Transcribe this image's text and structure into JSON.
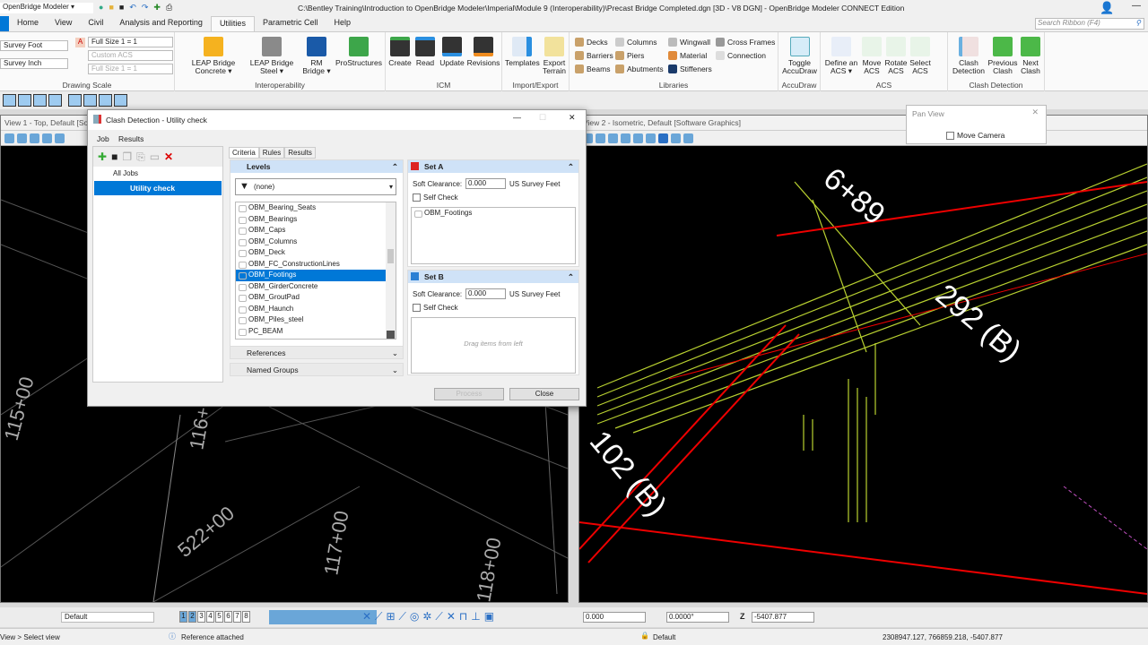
{
  "app": {
    "name": "OpenBridge Modeler",
    "title": "C:\\Bentley Training\\Introduction to OpenBridge Modeler\\Imperial\\Module 9 (Interoperability)\\Precast Bridge Completed.dgn [3D - V8 DGN] - OpenBridge Modeler CONNECT Edition",
    "search_placeholder": "Search Ribbon (F4)"
  },
  "tabs": [
    "Home",
    "View",
    "Civil",
    "Analysis and Reporting",
    "Utilities",
    "Parametric Cell",
    "Help"
  ],
  "ribbon": {
    "drawing_scale": {
      "label": "Drawing Scale",
      "unit1": "Survey Foot",
      "unit2": "Survey Inch",
      "scale1": "Full Size 1 = 1",
      "scale2": "Custom ACS",
      "scale3": "Full Size 1 = 1"
    },
    "interop": {
      "label": "Interoperability",
      "b1": "LEAP Bridge Concrete ▾",
      "b2": "LEAP Bridge Steel ▾",
      "b3": "RM Bridge ▾",
      "b4": "ProStructures"
    },
    "icm": {
      "label": "ICM",
      "b": [
        "Create",
        "Read",
        "Update",
        "Revisions"
      ]
    },
    "importexport": {
      "label": "Import/Export",
      "b1": "Templates",
      "b2": "Export Terrain"
    },
    "libraries": {
      "label": "Libraries",
      "items": [
        "Decks",
        "Barriers",
        "Beams",
        "Columns",
        "Piers",
        "Abutments",
        "Wingwall",
        "Material",
        "Stiffeners",
        "Cross Frames",
        "Connection"
      ]
    },
    "accudraw": {
      "label": "AccuDraw",
      "b": "Toggle AccuDraw"
    },
    "acs": {
      "label": "ACS",
      "b": [
        "Define an ACS ▾",
        "Move ACS",
        "Rotate ACS",
        "Select ACS"
      ]
    },
    "clash": {
      "label": "Clash Detection",
      "b": [
        "Clash Detection",
        "Previous Clash",
        "Next Clash"
      ]
    }
  },
  "views": {
    "v1": "View 1 - Top, Default [Software Graphics]",
    "v2": "View 2 - Isometric, Default [Software Graphics]",
    "v1_labels": [
      "115+00",
      "116+00",
      "522+00",
      "117+00",
      "118+00"
    ],
    "v2_labels": [
      "6+89",
      "292 (B)",
      "102 (B)"
    ]
  },
  "pan_view": {
    "title": "Pan View",
    "move_camera": "Move Camera"
  },
  "dialog": {
    "title": "Clash Detection - Utility check",
    "menu": [
      "Job",
      "Results"
    ],
    "tree": {
      "all": "All Jobs",
      "job": "Utility check"
    },
    "tabs": [
      "Criteria",
      "Rules",
      "Results"
    ],
    "levels_header": "Levels",
    "filter": "(none)",
    "levels": [
      "OBM_Bearing_Seats",
      "OBM_Bearings",
      "OBM_Caps",
      "OBM_Columns",
      "OBM_Deck",
      "OBM_FC_ConstructionLines",
      "OBM_Footings",
      "OBM_GirderConcrete",
      "OBM_GroutPad",
      "OBM_Haunch",
      "OBM_Piles_steel",
      "PC_BEAM"
    ],
    "selected_level": "OBM_Footings",
    "references": "References",
    "named_groups": "Named Groups",
    "setA": {
      "title": "Set A",
      "soft_label": "Soft Clearance:",
      "soft_value": "0.000",
      "units": "US Survey Feet",
      "self_check": "Self Check",
      "items": [
        "OBM_Footings"
      ]
    },
    "setB": {
      "title": "Set B",
      "soft_label": "Soft Clearance:",
      "soft_value": "0.000",
      "units": "US Survey Feet",
      "self_check": "Self Check",
      "placeholder": "Drag items from left"
    },
    "process": "Process",
    "close": "Close"
  },
  "bottom": {
    "level": "Default",
    "views": [
      "1",
      "2",
      "3",
      "4",
      "5",
      "6",
      "7",
      "8"
    ],
    "x": "0.000",
    "angle": "0.0000°",
    "z_label": "Z",
    "z": "-5407.877"
  },
  "status": {
    "prompt": "View > Select view",
    "message": "Reference attached",
    "active_level": "Default",
    "coords": "2308947.127, 766859.218, -5407.877"
  }
}
